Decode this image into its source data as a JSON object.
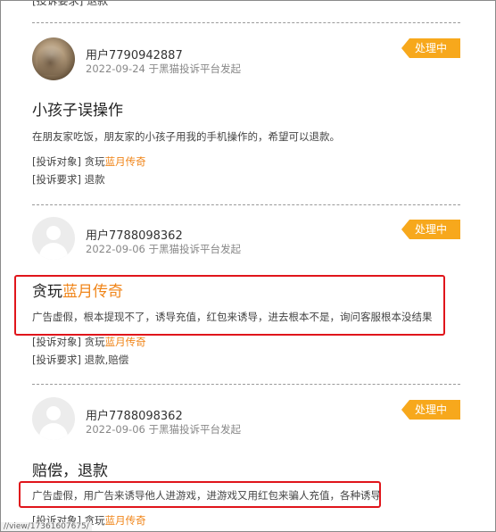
{
  "partial_top": "[投诉要求] 退款",
  "items": [
    {
      "user": "用户7790942887",
      "meta": "2022-09-24 于黑猫投诉平台发起",
      "status": "处理中",
      "title_prefix": "小孩子误操作",
      "title_highlight": "",
      "desc": "在朋友家吃饭，朋友家的小孩子用我的手机操作的，希望可以退款。",
      "target_label": "[投诉对象]",
      "target_prefix": "贪玩",
      "target_highlight": "蓝月传奇",
      "demand_label": "[投诉要求]",
      "demand_value": "退款"
    },
    {
      "user": "用户7788098362",
      "meta": "2022-09-06 于黑猫投诉平台发起",
      "status": "处理中",
      "title_prefix": "贪玩",
      "title_highlight": "蓝月传奇",
      "desc": "广告虚假，根本提现不了，诱导充值，红包来诱导，进去根本不是，询问客服根本没结果",
      "target_label": "[投诉对象]",
      "target_prefix": "贪玩",
      "target_highlight": "蓝月传奇",
      "demand_label": "[投诉要求]",
      "demand_value": "退款,赔偿"
    },
    {
      "user": "用户7788098362",
      "meta": "2022-09-06 于黑猫投诉平台发起",
      "status": "处理中",
      "title_prefix": "赔偿，退款",
      "title_highlight": "",
      "desc": "广告虚假，用广告来诱导他人进游戏，进游戏又用红包来骗人充值，各种诱导",
      "target_label": "[投诉对象]",
      "target_prefix": "贪玩",
      "target_highlight": "蓝月传奇"
    }
  ],
  "status_url": "//view/17361607675/",
  "colors": {
    "badge": "#f7a81c",
    "highlight": "#f08519",
    "redbox": "#e0151b"
  }
}
